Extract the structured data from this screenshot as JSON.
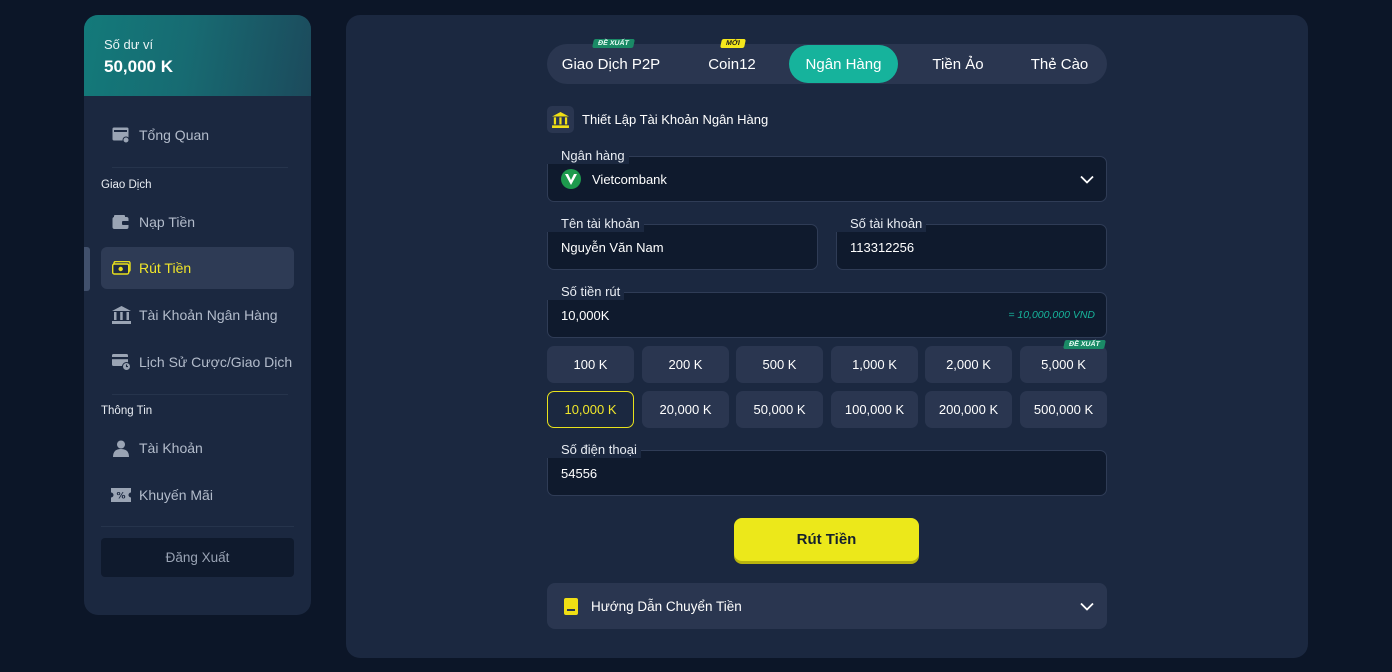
{
  "sidebar": {
    "balance_label": "Số dư ví",
    "balance_value": "50,000 K",
    "overview": "Tổng Quan",
    "section_transactions": "Giao Dịch",
    "deposit": "Nạp Tiền",
    "withdraw": "Rút Tiền",
    "bank_accounts": "Tài Khoản Ngân Hàng",
    "history": "Lịch Sử Cược/Giao Dịch",
    "section_info": "Thông Tin",
    "account": "Tài Khoản",
    "promotions": "Khuyến Mãi",
    "logout": "Đăng Xuất"
  },
  "tabs": [
    {
      "label": "Giao Dịch P2P",
      "badge": "ĐỀ XUẤT",
      "active": false
    },
    {
      "label": "Coin12",
      "badge": "MỚI",
      "active": false
    },
    {
      "label": "Ngân Hàng",
      "badge": "",
      "active": true
    },
    {
      "label": "Tiền Ảo",
      "badge": "",
      "active": false
    },
    {
      "label": "Thẻ Cào",
      "badge": "",
      "active": false
    }
  ],
  "form": {
    "section_title": "Thiết Lập Tài Khoản Ngân Hàng",
    "bank_label": "Ngân hàng",
    "bank_value": "Vietcombank",
    "account_name_label": "Tên tài khoản",
    "account_name_value": "Nguyễn Văn Nam",
    "account_number_label": "Số tài khoản",
    "account_number_value": "113312256",
    "amount_label": "Số tiền rút",
    "amount_value": "10,000K",
    "amount_hint": "= 10,000,000 VND",
    "phone_label": "Số điện thoại",
    "phone_value": "54556",
    "submit": "Rút Tiền",
    "guide": "Hướng Dẫn Chuyển Tiền"
  },
  "amounts": [
    {
      "label": "100 K",
      "badge": "",
      "selected": false
    },
    {
      "label": "200 K",
      "badge": "",
      "selected": false
    },
    {
      "label": "500 K",
      "badge": "",
      "selected": false
    },
    {
      "label": "1,000 K",
      "badge": "",
      "selected": false
    },
    {
      "label": "2,000 K",
      "badge": "",
      "selected": false
    },
    {
      "label": "5,000 K",
      "badge": "ĐỀ XUẤT",
      "selected": false
    },
    {
      "label": "10,000 K",
      "badge": "",
      "selected": true
    },
    {
      "label": "20,000 K",
      "badge": "",
      "selected": false
    },
    {
      "label": "50,000 K",
      "badge": "",
      "selected": false
    },
    {
      "label": "100,000 K",
      "badge": "",
      "selected": false
    },
    {
      "label": "200,000 K",
      "badge": "",
      "selected": false
    },
    {
      "label": "500,000 K",
      "badge": "",
      "selected": false
    }
  ],
  "colors": {
    "accent_teal": "#16b39c",
    "accent_yellow": "#ece81a",
    "panel": "#1b2840",
    "background": "#0c1628"
  }
}
